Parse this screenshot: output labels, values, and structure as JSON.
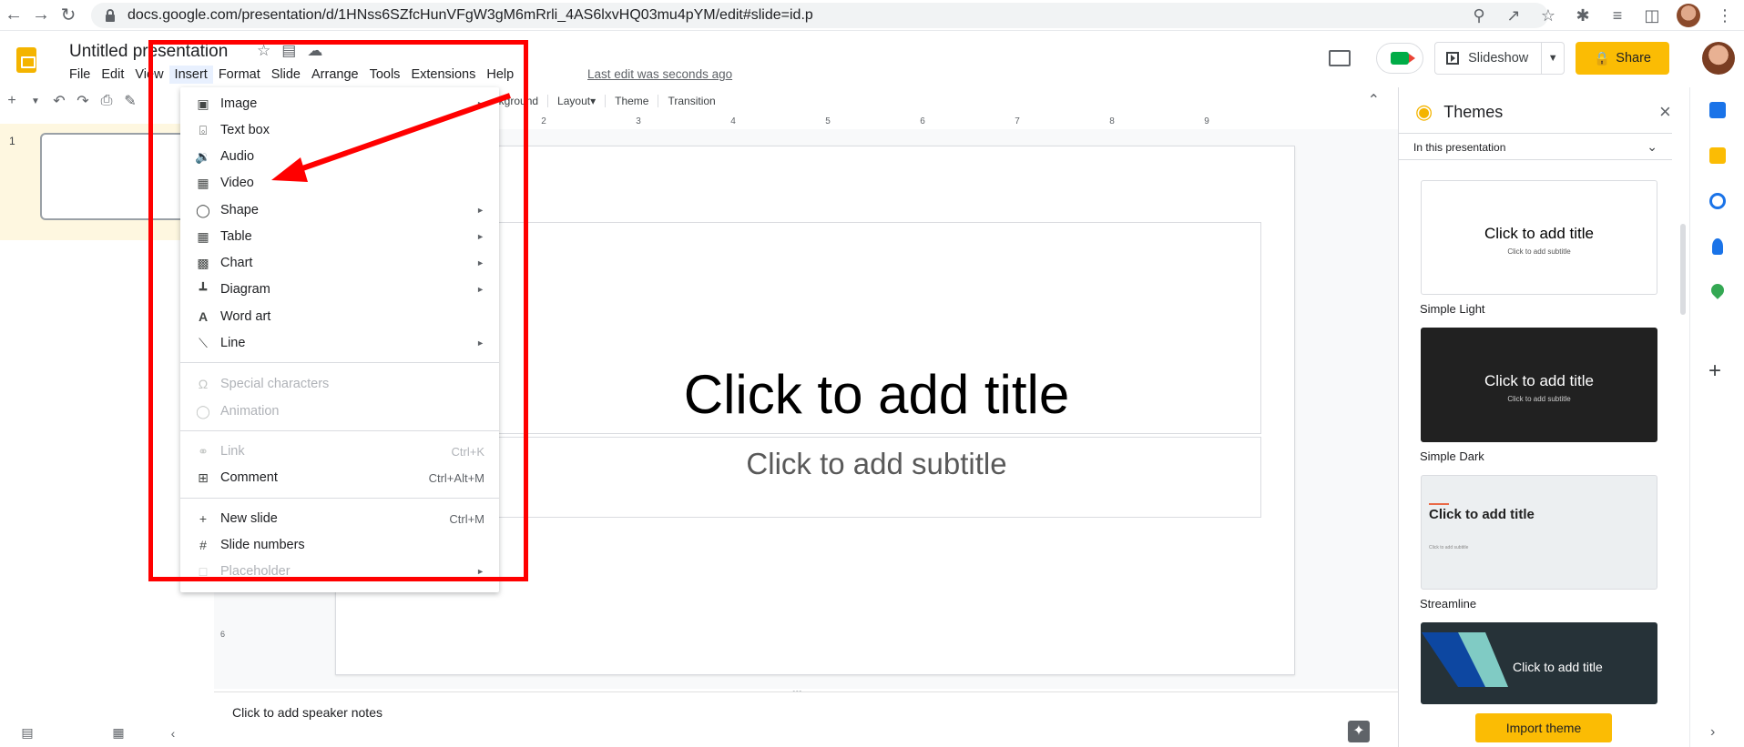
{
  "browser": {
    "url": "docs.google.com/presentation/d/1HNss6SZfcHunVFgW3gM6mRrli_4AS6lxvHQ03mu4pYM/edit#slide=id.p"
  },
  "app": {
    "title": "Untitled presentation",
    "menu": [
      "File",
      "Edit",
      "View",
      "Insert",
      "Format",
      "Slide",
      "Arrange",
      "Tools",
      "Extensions",
      "Help"
    ],
    "last_edit": "Last edit was seconds ago",
    "slideshow_label": "Slideshow",
    "share_label": "Share",
    "accent_color": "#fbbc04"
  },
  "toolbar": {
    "background_label": "Background",
    "layout_label": "Layout▾",
    "theme_label": "Theme",
    "transition_label": "Transition"
  },
  "ruler": {
    "ticks": [
      "2",
      "3",
      "4",
      "5",
      "6",
      "7",
      "8",
      "9"
    ],
    "left_tick": "6"
  },
  "filmstrip": {
    "slide_number": "1"
  },
  "slide": {
    "title_placeholder": "Click to add title",
    "subtitle_placeholder": "Click to add subtitle"
  },
  "notes": {
    "placeholder": "Click to add speaker notes"
  },
  "insert_menu": {
    "items": [
      {
        "label": "Image",
        "icon": "image-icon",
        "submenu": true
      },
      {
        "label": "Text box",
        "icon": "textbox-icon"
      },
      {
        "label": "Audio",
        "icon": "audio-icon"
      },
      {
        "label": "Video",
        "icon": "video-icon"
      },
      {
        "label": "Shape",
        "icon": "shape-icon",
        "submenu": true
      },
      {
        "label": "Table",
        "icon": "table-icon",
        "submenu": true
      },
      {
        "label": "Chart",
        "icon": "chart-icon",
        "submenu": true
      },
      {
        "label": "Diagram",
        "icon": "diagram-icon",
        "submenu": true
      },
      {
        "label": "Word art",
        "icon": "wordart-icon"
      },
      {
        "label": "Line",
        "icon": "line-icon",
        "submenu": true
      },
      {
        "label": "Special characters",
        "icon": "omega-icon",
        "disabled": true
      },
      {
        "label": "Animation",
        "icon": "animation-icon",
        "disabled": true
      },
      {
        "label": "Link",
        "icon": "link-icon",
        "shortcut": "Ctrl+K",
        "disabled": true
      },
      {
        "label": "Comment",
        "icon": "comment-add-icon",
        "shortcut": "Ctrl+Alt+M"
      },
      {
        "label": "New slide",
        "icon": "plus-icon",
        "shortcut": "Ctrl+M"
      },
      {
        "label": "Slide numbers",
        "icon": "hash-icon"
      },
      {
        "label": "Placeholder",
        "icon": "placeholder-icon",
        "submenu": true,
        "disabled": true
      }
    ]
  },
  "themes": {
    "header": "Themes",
    "filter": "In this presentation",
    "cards": [
      {
        "name": "Simple Light",
        "title": "Click to add title",
        "subtitle": "Click to add subtitle",
        "bg": "#ffffff",
        "fg": "#000000"
      },
      {
        "name": "Simple Dark",
        "title": "Click to add title",
        "subtitle": "Click to add subtitle",
        "bg": "#212121",
        "fg": "#ffffff"
      },
      {
        "name": "Streamline",
        "title": "Click to add title",
        "subtitle": "Click to add subtitle",
        "bg": "#eceff1",
        "fg": "#212121"
      },
      {
        "name": "",
        "title": "Click to add title",
        "subtitle": "",
        "bg": "#263238",
        "fg": "#ffffff"
      }
    ],
    "import_label": "Import theme"
  },
  "annotation": {
    "color": "#ff0000"
  }
}
